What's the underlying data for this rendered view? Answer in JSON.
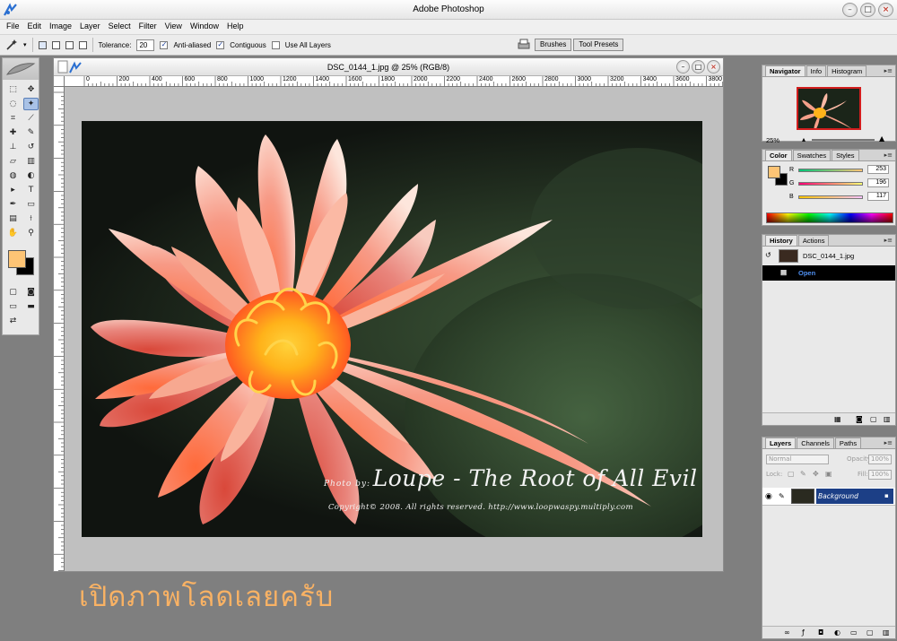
{
  "app": {
    "title": "Adobe Photoshop"
  },
  "menu": [
    "File",
    "Edit",
    "Image",
    "Layer",
    "Select",
    "Filter",
    "View",
    "Window",
    "Help"
  ],
  "options": {
    "tolerance_label": "Tolerance:",
    "tolerance_value": "20",
    "anti_aliased": "Anti-aliased",
    "contiguous": "Contiguous",
    "use_all_layers": "Use All Layers"
  },
  "palette_well": [
    "Brushes",
    "Tool Presets"
  ],
  "document": {
    "title": "DSC_0144_1.jpg @ 25% (RGB/8)",
    "ruler_labels": [
      "0",
      "200",
      "400",
      "600",
      "800",
      "1000",
      "1200",
      "1400",
      "1600",
      "1800",
      "2000",
      "2200",
      "2400",
      "2600",
      "2800",
      "3000",
      "3200",
      "3400",
      "3600",
      "3800"
    ]
  },
  "watermark": {
    "prefix": "Photo by:",
    "main": "Loupe - The Root of All Evil",
    "copyright": "Copyright© 2008. All rights reserved. http://www.loopwaspy.multiply.com"
  },
  "caption": "เปิดภาพโลดเลยครับ",
  "navigator": {
    "tabs": [
      "Navigator",
      "Info",
      "Histogram"
    ],
    "zoom": "25%"
  },
  "color_panel": {
    "tabs": [
      "Color",
      "Swatches",
      "Styles"
    ],
    "channels": [
      {
        "label": "R",
        "value": "253"
      },
      {
        "label": "G",
        "value": "196"
      },
      {
        "label": "B",
        "value": "117"
      }
    ],
    "foreground": "#fdc475",
    "background": "#000000"
  },
  "history": {
    "tabs": [
      "History",
      "Actions"
    ],
    "snapshot": "DSC_0144_1.jpg",
    "state": "Open"
  },
  "layers": {
    "tabs": [
      "Layers",
      "Channels",
      "Paths"
    ],
    "blend_mode": "Normal",
    "opacity_label": "Opacity:",
    "opacity": "100%",
    "lock_label": "Lock:",
    "fill_label": "Fill:",
    "fill": "100%",
    "layer_name": "Background"
  }
}
